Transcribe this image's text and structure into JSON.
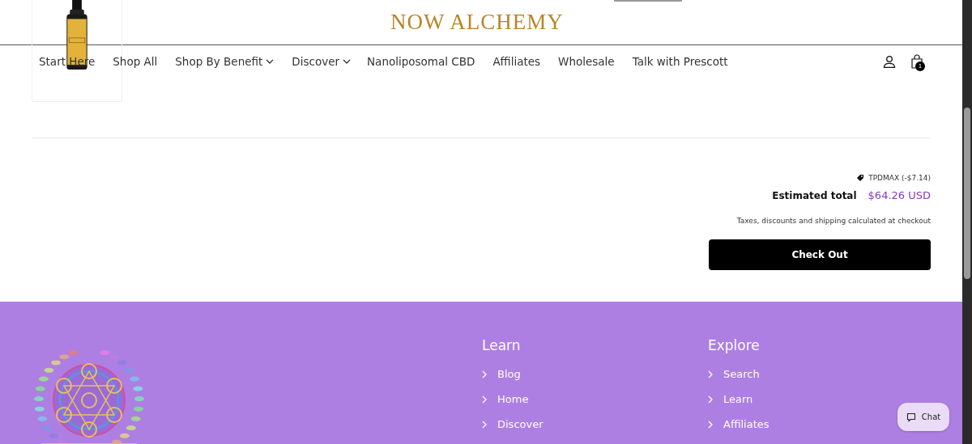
{
  "header": {
    "logo": "NOW ALCHEMY",
    "cart_count": "1"
  },
  "nav": [
    {
      "label": "Start Here",
      "dropdown": false
    },
    {
      "label": "Shop All",
      "dropdown": false
    },
    {
      "label": "Shop By Benefit",
      "dropdown": true
    },
    {
      "label": "Discover",
      "dropdown": true
    },
    {
      "label": "Nanoliposomal CBD",
      "dropdown": false
    },
    {
      "label": "Affiliates",
      "dropdown": false
    },
    {
      "label": "Wholesale",
      "dropdown": false
    },
    {
      "label": "Talk with Prescott",
      "dropdown": false
    }
  ],
  "cart_summary": {
    "discount": "TPDMAX (-$7.14)",
    "total_label": "Estimated total",
    "total_value": "$64.26 USD",
    "note": "Taxes, discounts and shipping calculated at checkout",
    "checkout_button": "Check Out"
  },
  "footer": {
    "columns": [
      {
        "heading": "Learn",
        "links": [
          "Blog",
          "Home",
          "Discover"
        ]
      },
      {
        "heading": "Explore",
        "links": [
          "Search",
          "Learn",
          "Affiliates"
        ]
      }
    ]
  },
  "chat_button": "Chat"
}
